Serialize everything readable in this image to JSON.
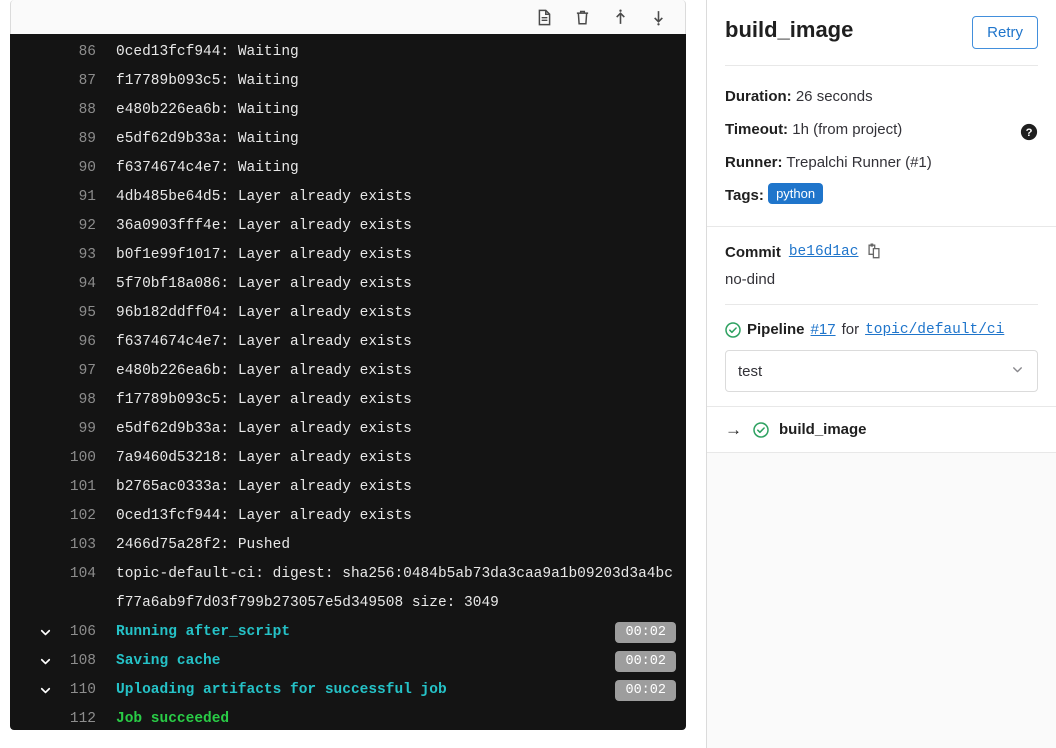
{
  "log_toolbar": {
    "buttons": [
      {
        "name": "show-complete-raw",
        "icon": "file-icon"
      },
      {
        "name": "erase-job-log",
        "icon": "trash-icon"
      },
      {
        "name": "scroll-to-top",
        "icon": "arrow-up-icon"
      },
      {
        "name": "scroll-to-bottom",
        "icon": "arrow-down-icon"
      }
    ]
  },
  "log": {
    "lines": [
      {
        "num": "86",
        "text": "0ced13fcf944: Waiting",
        "style": "plain"
      },
      {
        "num": "87",
        "text": "f17789b093c5: Waiting",
        "style": "plain"
      },
      {
        "num": "88",
        "text": "e480b226ea6b: Waiting",
        "style": "plain"
      },
      {
        "num": "89",
        "text": "e5df62d9b33a: Waiting",
        "style": "plain"
      },
      {
        "num": "90",
        "text": "f6374674c4e7: Waiting",
        "style": "plain"
      },
      {
        "num": "91",
        "text": "4db485be64d5: Layer already exists",
        "style": "plain"
      },
      {
        "num": "92",
        "text": "36a0903fff4e: Layer already exists",
        "style": "plain"
      },
      {
        "num": "93",
        "text": "b0f1e99f1017: Layer already exists",
        "style": "plain"
      },
      {
        "num": "94",
        "text": "5f70bf18a086: Layer already exists",
        "style": "plain"
      },
      {
        "num": "95",
        "text": "96b182ddff04: Layer already exists",
        "style": "plain"
      },
      {
        "num": "96",
        "text": "f6374674c4e7: Layer already exists",
        "style": "plain"
      },
      {
        "num": "97",
        "text": "e480b226ea6b: Layer already exists",
        "style": "plain"
      },
      {
        "num": "98",
        "text": "f17789b093c5: Layer already exists",
        "style": "plain"
      },
      {
        "num": "99",
        "text": "e5df62d9b33a: Layer already exists",
        "style": "plain"
      },
      {
        "num": "100",
        "text": "7a9460d53218: Layer already exists",
        "style": "plain"
      },
      {
        "num": "101",
        "text": "b2765ac0333a: Layer already exists",
        "style": "plain"
      },
      {
        "num": "102",
        "text": "0ced13fcf944: Layer already exists",
        "style": "plain"
      },
      {
        "num": "103",
        "text": "2466d75a28f2: Pushed",
        "style": "plain"
      },
      {
        "num": "104",
        "text": "topic-default-ci: digest: sha256:0484b5ab73da3caa9a1b09203d3a4bcf77a6ab9f7d03f799b273057e5d349508 size: 3049",
        "style": "plain"
      },
      {
        "num": "106",
        "text": "Running after_script",
        "style": "section",
        "duration": "00:02",
        "collapsible": true
      },
      {
        "num": "108",
        "text": "Saving cache",
        "style": "section",
        "duration": "00:02",
        "collapsible": true
      },
      {
        "num": "110",
        "text": "Uploading artifacts for successful job",
        "style": "section",
        "duration": "00:02",
        "collapsible": true
      },
      {
        "num": "112",
        "text": "Job succeeded",
        "style": "success"
      }
    ]
  },
  "sidebar": {
    "job_name": "build_image",
    "retry_label": "Retry",
    "meta": [
      {
        "label": "Duration:",
        "value": "26 seconds"
      },
      {
        "label": "Timeout:",
        "value": "1h (from project)",
        "has_help": true
      },
      {
        "label": "Runner:",
        "value": "Trepalchi Runner (#1)"
      }
    ],
    "tags_label": "Tags:",
    "tags": [
      "python"
    ],
    "commit_label": "Commit",
    "commit_sha": "be16d1ac",
    "commit_message": "no-dind",
    "pipeline": {
      "label": "Pipeline",
      "number": "#17",
      "for_word": "for",
      "ref": "topic/default/ci",
      "status": "success"
    },
    "stage_select_value": "test",
    "jobs": [
      {
        "arrow": "→",
        "name": "build_image",
        "status": "success"
      }
    ]
  },
  "colors": {
    "log_bg": "#141414",
    "section_text": "#25c2c7",
    "success_text": "#29cc46",
    "link": "#1f75cb",
    "tag_bg": "#1f75cb",
    "duration_badge": "#9d9d9d",
    "status_green": "#2da160"
  }
}
